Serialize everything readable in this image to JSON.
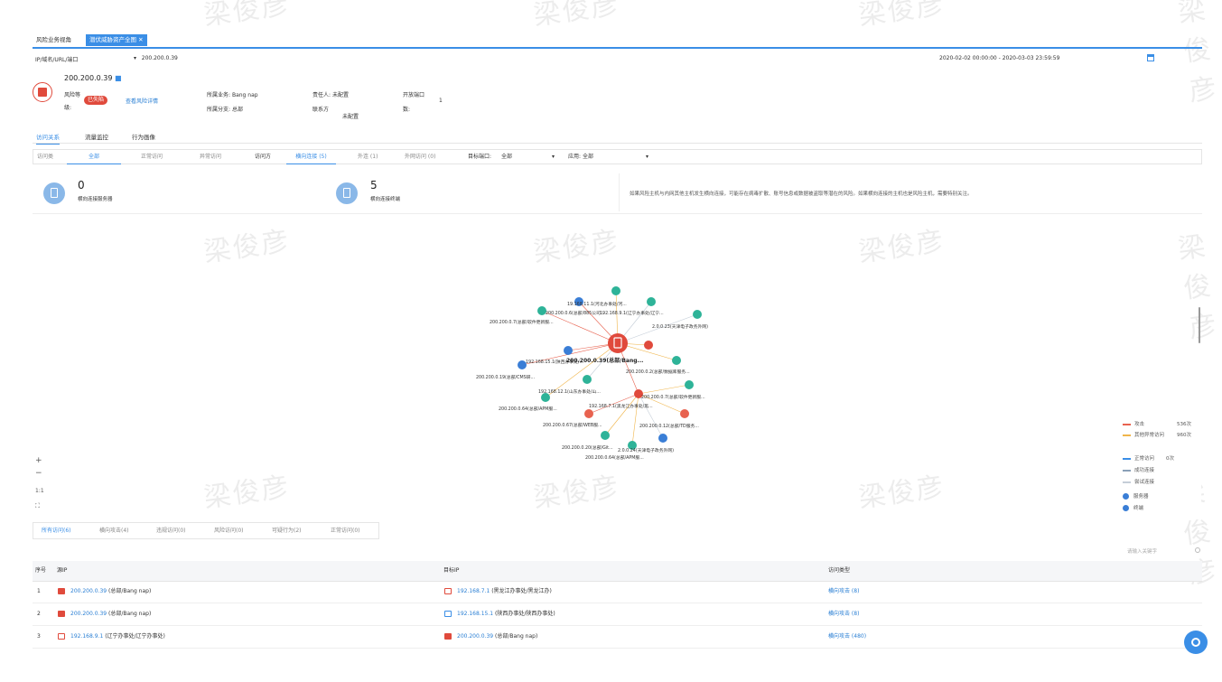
{
  "watermark_text": "梁俊彦",
  "tabs": [
    {
      "label": "风险业务视角",
      "active": false
    },
    {
      "label": "潜伏威胁资产全图",
      "active": true
    }
  ],
  "filter": {
    "ip_label": "IP/域名/URL/端口",
    "ip_value": "200.200.0.39",
    "date_range": "2020-02-02 00:00:00 - 2020-03-03 23:59:59"
  },
  "asset": {
    "ip": "200.200.0.39",
    "risk_label_line1": "风险等",
    "risk_label_line2": "级:",
    "risk_badge": "已失陷",
    "risk_link": "查看风险详情",
    "business_label": "所属业务:",
    "business_value": "Bang nap",
    "branch_label": "所属分支:",
    "branch_value": "总部",
    "owner_label": "责任人:",
    "owner_value": "未配置",
    "contact_label": "联系方",
    "contact_value": "未配置",
    "port_label_line1": "开放端口",
    "port_label_line2": "数:",
    "port_value": "1"
  },
  "main_tabs": [
    {
      "label": "访问关系",
      "active": true
    },
    {
      "label": "流量监控",
      "active": false
    },
    {
      "label": "行为画像",
      "active": false
    }
  ],
  "sub_filters": {
    "visit_label": "访问类",
    "all": "全部",
    "normal": "正常访问",
    "abnormal": "异常访问",
    "direction_label": "访问方",
    "lateral": "横向连接 (5)",
    "outbound": "外连 (1)",
    "external": "外网访问 (0)",
    "target_port_label": "目标端口:",
    "target_port_value": "全部",
    "app_label": "应用:",
    "app_value": "全部"
  },
  "stats": [
    {
      "value": "0",
      "label": "横向连接服务器"
    },
    {
      "value": "5",
      "label": "横向连接终端"
    }
  ],
  "notice": "如果风险主机与内网其他主机发生横向连接，可能存在病毒扩散、账号信息或数据被盗取等潜在的风险。如果横向连接的主机也是风险主机，需要特别关注。",
  "graph": {
    "center_label": "200.200.0.39(总部/Bang...",
    "node_labels": [
      "19.168.11.1(河北办事处/河...",
      "200.200.0.6(总部/885公司...",
      "192.168.9.1(辽宁办事处/辽宁...",
      "200.200.0.7(总部/软件更新服...",
      "2.0.0.23(天津电子政务外网)",
      "192.168.15.1(陕西办事处/...",
      "200.200.0.2(总部/数据库服务...",
      "200.200.0.19(总部/CMS研...",
      "192.168.12.1(山东办事处/山...",
      "200.200.0.7(总部/软件更新服...",
      "192.168.7.1(黑龙江办事处/黑...",
      "200.200.0.64(总部/APM服...",
      "200.200.0.67(总部/WEB服...",
      "200.200.0.12(总部/TD服务...",
      "200.200.0.20(总部/Git...",
      "2.0.0.24(天津电子政务外网)",
      "200.200.0.64(总部/APM服..."
    ]
  },
  "legend": [
    {
      "label": "攻击",
      "count": "536次",
      "color": "#e8624f"
    },
    {
      "label": "其他异常访问",
      "count": "960次",
      "color": "#f0b54a"
    },
    {
      "label": "正常访问",
      "count": "0次",
      "color": "#3a8ee6"
    },
    {
      "label": "成功连接",
      "count": "",
      "color": "#8aa0b8"
    },
    {
      "label": "尝试连接",
      "count": "",
      "color": "#c5ced8"
    },
    {
      "label": "服务器",
      "count": "",
      "color": "#3a8ee6"
    },
    {
      "label": "终端",
      "count": "",
      "color": "#3a8ee6"
    }
  ],
  "zoom_controls": [
    "+",
    "−",
    "1:1",
    "⛶"
  ],
  "bottom_tabs": [
    {
      "label": "所有访问(6)",
      "active": true
    },
    {
      "label": "横向攻击(4)",
      "active": false
    },
    {
      "label": "违规访问(0)",
      "active": false
    },
    {
      "label": "风险访问(0)",
      "active": false
    },
    {
      "label": "可疑行为(2)",
      "active": false
    },
    {
      "label": "正常访问(0)",
      "active": false
    }
  ],
  "search_placeholder": "请输入关键字",
  "table": {
    "headers": [
      "序号",
      "源IP",
      "目标IP",
      "访问类型"
    ],
    "rows": [
      {
        "idx": "1",
        "src_ip": "200.200.0.39",
        "src_note": "(总部/Bang nap)",
        "dst_ip": "192.168.7.1",
        "dst_note": "(黑龙江办事处/黑龙江办)",
        "type": "横向攻击 (8)"
      },
      {
        "idx": "2",
        "src_ip": "200.200.0.39",
        "src_note": "(总部/Bang nap)",
        "dst_ip": "192.168.15.1",
        "dst_note": "(陕西办事处/陕西办事处)",
        "type": "横向攻击 (8)"
      },
      {
        "idx": "3",
        "src_ip": "192.168.9.1",
        "src_note": "(辽宁办事处/辽宁办事处)",
        "dst_ip": "200.200.0.39",
        "dst_note": "(总部/Bang nap)",
        "type": "横向攻击 (480)"
      }
    ]
  }
}
